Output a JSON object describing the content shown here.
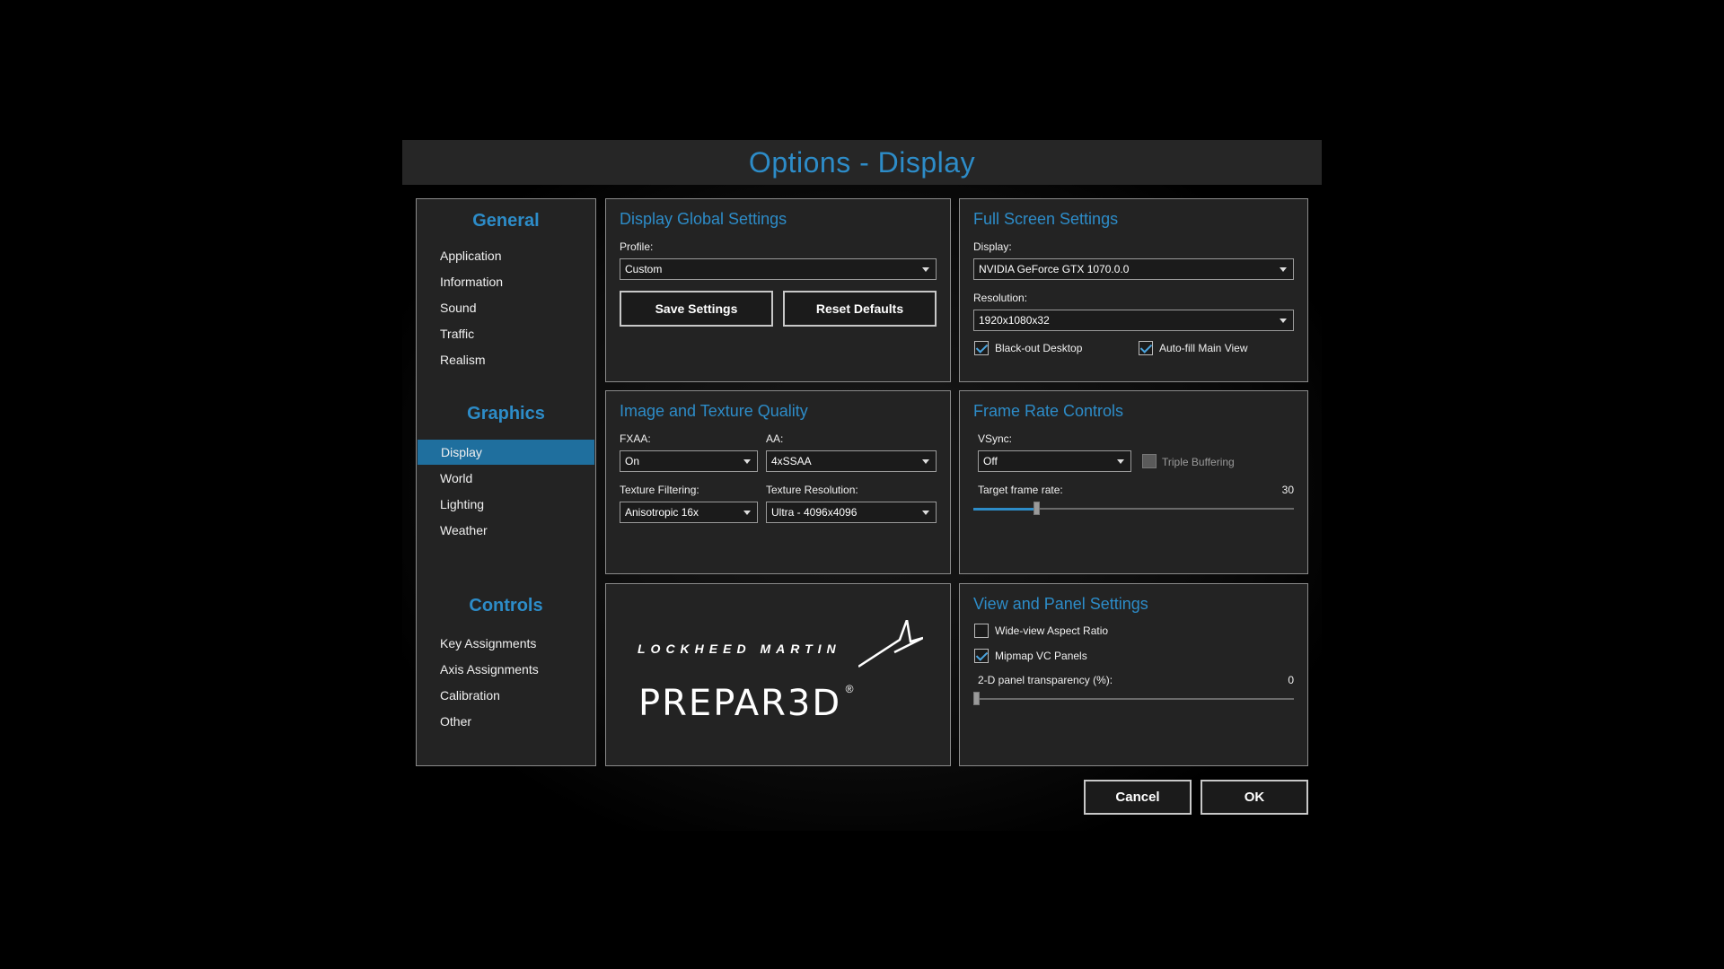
{
  "window": {
    "title": "Options - Display"
  },
  "sidebar": {
    "sections": [
      {
        "heading": "General",
        "items": [
          "Application",
          "Information",
          "Sound",
          "Traffic",
          "Realism"
        ]
      },
      {
        "heading": "Graphics",
        "items": [
          "Display",
          "World",
          "Lighting",
          "Weather"
        ]
      },
      {
        "heading": "Controls",
        "items": [
          "Key Assignments",
          "Axis Assignments",
          "Calibration",
          "Other"
        ]
      }
    ],
    "active_item": "Display"
  },
  "display_global": {
    "title": "Display Global Settings",
    "profile_label": "Profile:",
    "profile_value": "Custom",
    "save_label": "Save Settings",
    "reset_label": "Reset Defaults"
  },
  "full_screen": {
    "title": "Full Screen Settings",
    "display_label": "Display:",
    "display_value": "NVIDIA GeForce GTX 1070.0.0",
    "resolution_label": "Resolution:",
    "resolution_value": "1920x1080x32",
    "blackout_label": "Black-out Desktop",
    "blackout_checked": true,
    "autofill_label": "Auto-fill Main View",
    "autofill_checked": true
  },
  "image_quality": {
    "title": "Image and Texture Quality",
    "fxaa_label": "FXAA:",
    "fxaa_value": "On",
    "aa_label": "AA:",
    "aa_value": "4xSSAA",
    "filtering_label": "Texture Filtering:",
    "filtering_value": "Anisotropic 16x",
    "resolution_label": "Texture Resolution:",
    "resolution_value": "Ultra - 4096x4096"
  },
  "frame_rate": {
    "title": "Frame Rate Controls",
    "vsync_label": "VSync:",
    "vsync_value": "Off",
    "triple_label": "Triple Buffering",
    "triple_checked": false,
    "target_label": "Target frame rate:",
    "target_value": "30",
    "target_fraction": 0.19
  },
  "view_panel": {
    "title": "View and Panel Settings",
    "wide_label": "Wide-view Aspect Ratio",
    "wide_checked": false,
    "mipmap_label": "Mipmap VC Panels",
    "mipmap_checked": true,
    "transparency_label": "2-D panel transparency (%):",
    "transparency_value": "0",
    "transparency_fraction": 0
  },
  "logo": {
    "company": "LOCKHEED MARTIN",
    "product": "PREPAR3D"
  },
  "footer": {
    "cancel_label": "Cancel",
    "ok_label": "OK"
  },
  "colors": {
    "accent": "#2d8cc8",
    "selected_bg": "#1f6f9e",
    "panel_bg": "#232323"
  }
}
